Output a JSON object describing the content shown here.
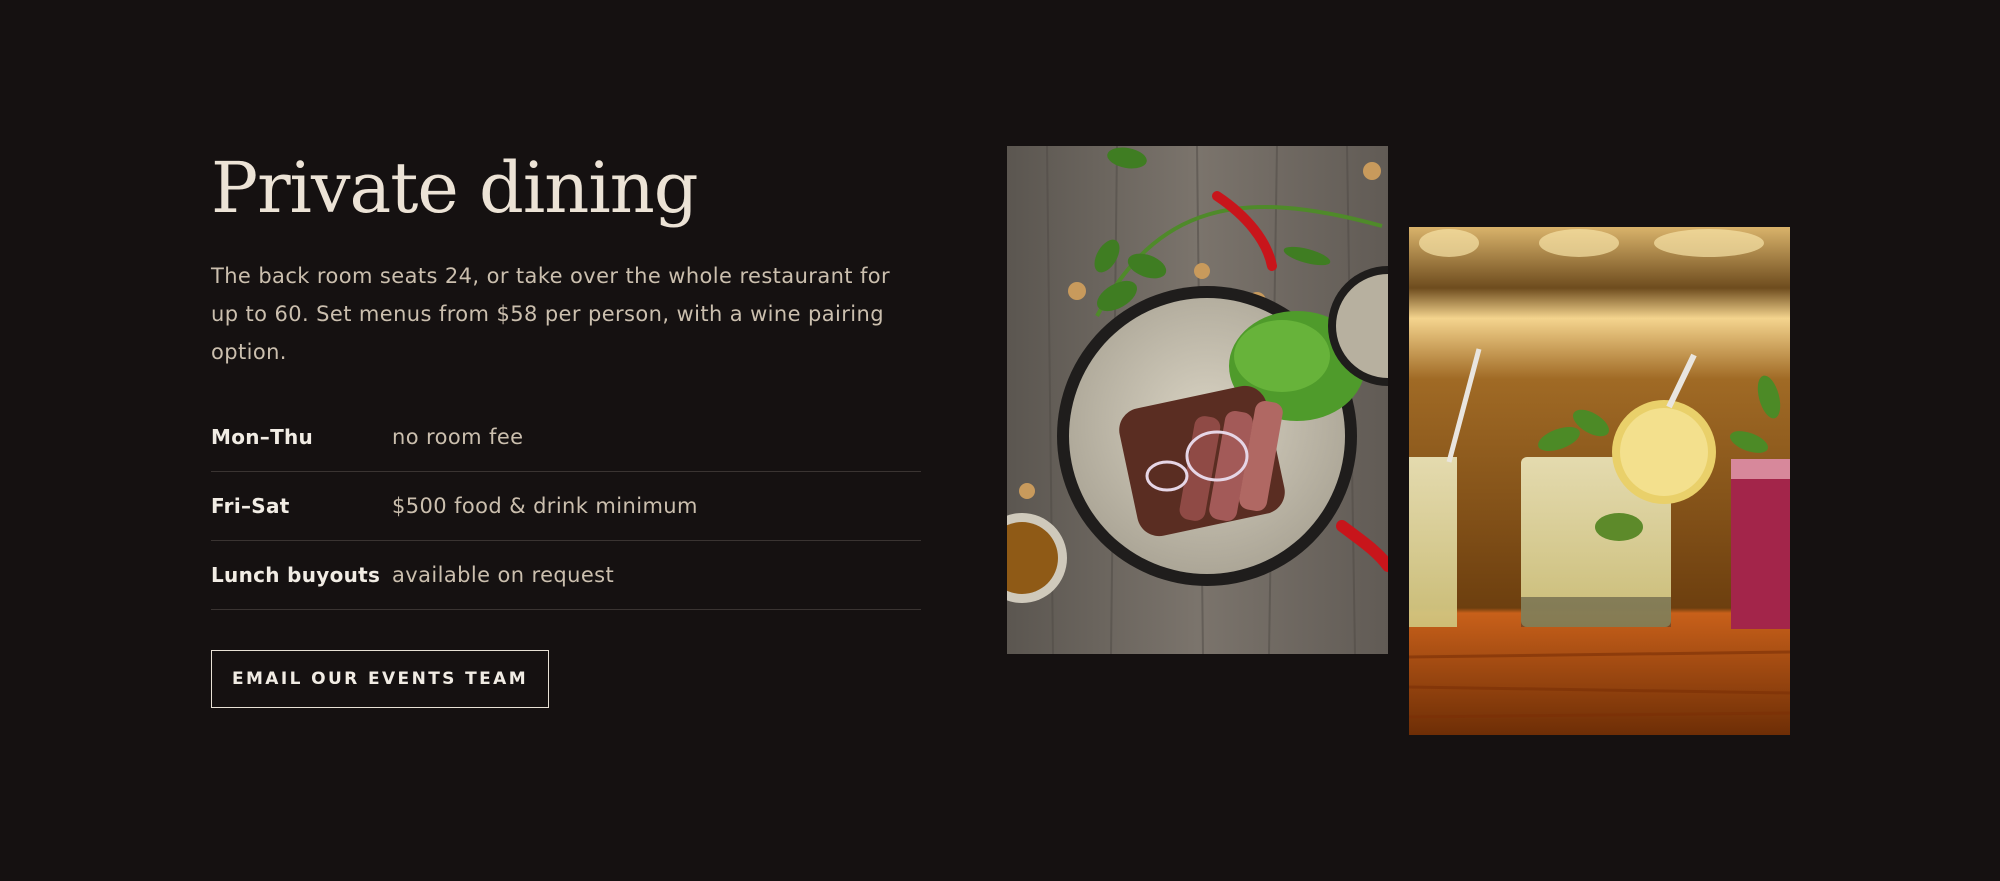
{
  "section": {
    "title": "Private dining",
    "description": "The back room seats 24, or take over the whole restaurant for up to 60. Set menus from $58 per person, with a wine pairing option."
  },
  "rates": [
    {
      "day": "Mon–Thu",
      "value": "no room fee"
    },
    {
      "day": "Fri–Sat",
      "value": "$500 food & drink minimum"
    },
    {
      "day": "Lunch buyouts",
      "value": "available on request"
    }
  ],
  "cta": {
    "label": "EMAIL OUR EVENTS TEAM"
  },
  "images": {
    "food_photo": "plated steak with herbs and chilies",
    "drinks_photo": "cocktails on a bar counter"
  },
  "colors": {
    "background": "#151111",
    "heading": "#ece3d6",
    "body_text": "#cbbfae",
    "divider": "#3a3432"
  }
}
